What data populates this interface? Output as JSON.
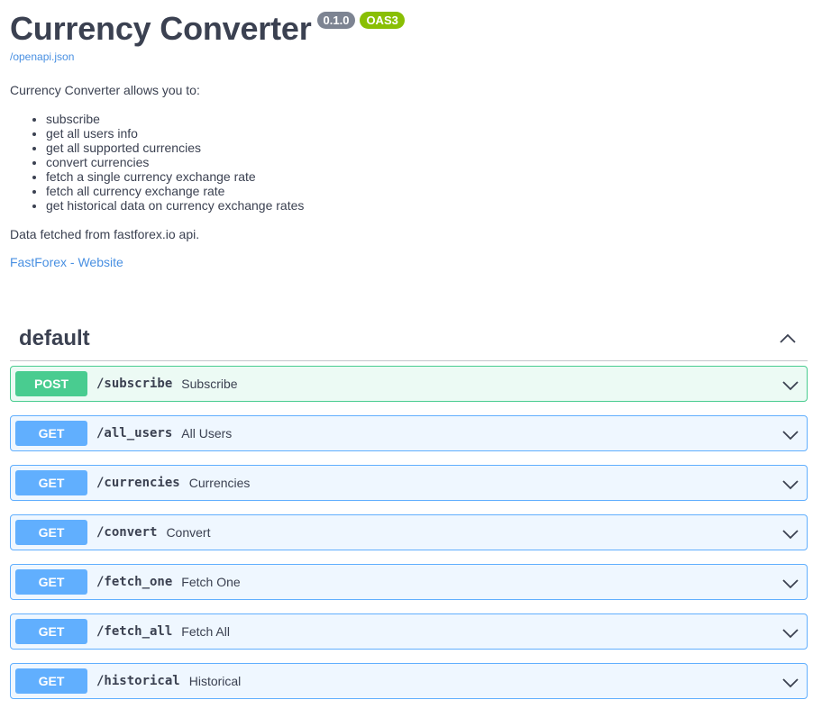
{
  "info": {
    "title": "Currency Converter",
    "version": "0.1.0",
    "oas": "OAS3",
    "spec_link": "/openapi.json",
    "intro": "Currency Converter allows you to:",
    "features": [
      "subscribe",
      "get all users info",
      "get all supported currencies",
      "convert currencies",
      "fetch a single currency exchange rate",
      "fetch all currency exchange rate",
      "get historical data on currency exchange rates"
    ],
    "data_source": "Data fetched from fastforex.io api.",
    "website_link": "FastForex - Website"
  },
  "section": {
    "title": "default",
    "toggle_icon": "chevron-up-icon"
  },
  "operations": [
    {
      "method": "POST",
      "path": "/subscribe",
      "summary": "Subscribe"
    },
    {
      "method": "GET",
      "path": "/all_users",
      "summary": "All Users"
    },
    {
      "method": "GET",
      "path": "/currencies",
      "summary": "Currencies"
    },
    {
      "method": "GET",
      "path": "/convert",
      "summary": "Convert"
    },
    {
      "method": "GET",
      "path": "/fetch_one",
      "summary": "Fetch One"
    },
    {
      "method": "GET",
      "path": "/fetch_all",
      "summary": "Fetch All"
    },
    {
      "method": "GET",
      "path": "/historical",
      "summary": "Historical"
    }
  ],
  "colors": {
    "get": "#61affe",
    "post": "#49cc90",
    "link": "#4990e2",
    "text": "#3b4151",
    "version_badge": "#7d8492",
    "oas_badge": "#89bf04"
  }
}
